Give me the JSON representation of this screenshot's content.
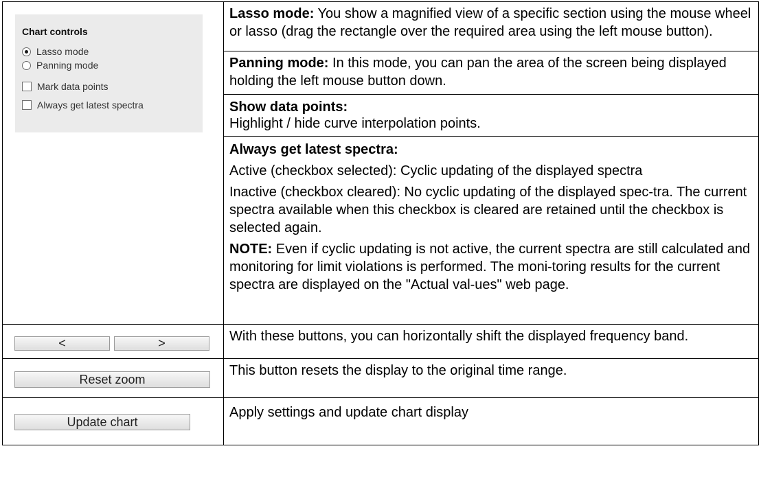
{
  "chart_controls": {
    "title": "Chart controls",
    "lasso_label": "Lasso mode",
    "panning_label": "Panning mode",
    "mark_label": "Mark data points",
    "always_label": "Always get latest spectra",
    "selected_mode": "Lasso mode",
    "mark_checked": false,
    "always_checked": false
  },
  "buttons": {
    "prev_label": "<",
    "next_label": ">",
    "reset_label": "Reset zoom",
    "update_label": "Update chart"
  },
  "descriptions": {
    "lasso_title": "Lasso mode:",
    "lasso_text": " You show a magnified view of a specific section using the mouse wheel or lasso (drag the rectangle over the required area using the left mouse button).",
    "panning_title": "Panning mode:",
    "panning_text": " In this mode, you can pan the area of the screen being displayed holding the left mouse button down.",
    "show_points_title": "Show data points:",
    "show_points_text": "Highlight / hide curve interpolation points.",
    "always_title": "Always get latest spectra:",
    "always_active": "Active (checkbox selected): Cyclic updating of the displayed spectra",
    "always_inactive": "Inactive (checkbox cleared): No cyclic updating of the displayed spec-tra. The current spectra available when this checkbox is cleared are retained until the checkbox is selected again.",
    "note_title": "NOTE:",
    "note_text": " Even if cyclic updating is not active, the current spectra are still calculated and monitoring for limit violations is performed. The moni-toring results for the current spectra are displayed on the \"Actual val-ues\" web page.",
    "shift_text": "With these buttons, you can horizontally shift the displayed frequency band.",
    "reset_text": "This button resets the display to the original time range.",
    "update_text": "Apply settings and update chart display"
  }
}
